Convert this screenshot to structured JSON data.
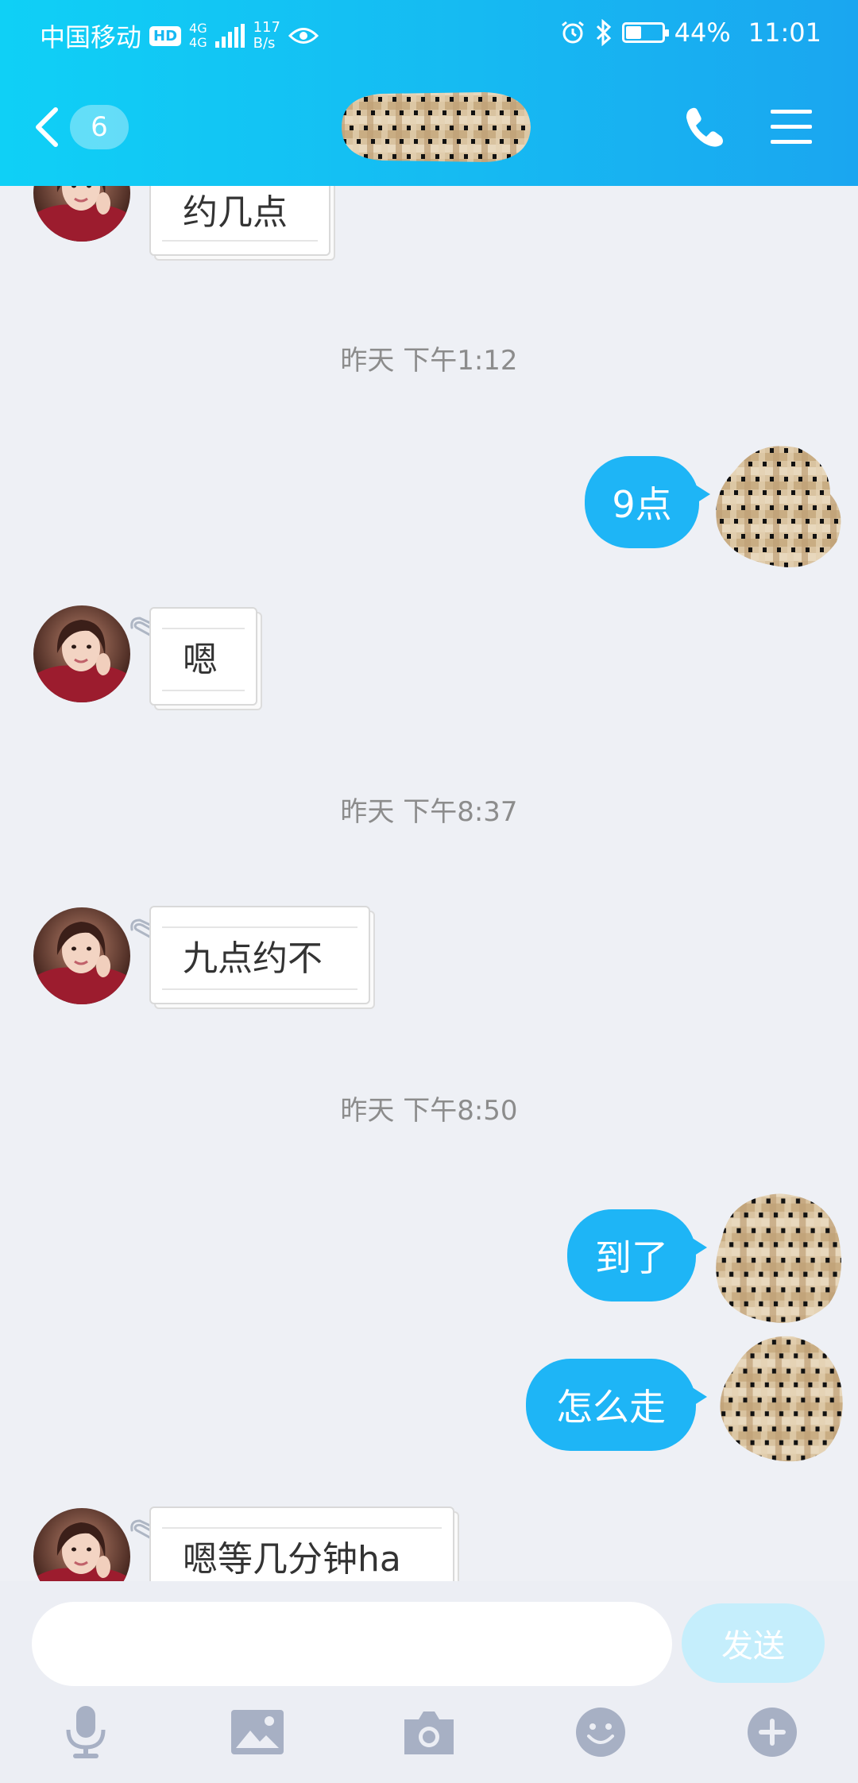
{
  "status_bar": {
    "carrier": "中国移动",
    "hd": "HD",
    "net_top": "4G",
    "net_bottom": "4G",
    "speed_value": "117",
    "speed_unit": "B/s",
    "battery": "44%",
    "battery_level": 0.44,
    "time": "11:01"
  },
  "nav": {
    "back_icon": "chevron-left-icon",
    "unread_count": "6",
    "phone_icon": "phone-icon",
    "menu_icon": "menu-icon"
  },
  "messages": [
    {
      "type": "incoming",
      "text": "约几点"
    },
    {
      "type": "timestamp",
      "text": "昨天 下午1:12"
    },
    {
      "type": "outgoing",
      "text": "9点"
    },
    {
      "type": "incoming",
      "text": "嗯"
    },
    {
      "type": "timestamp",
      "text": "昨天 下午8:37"
    },
    {
      "type": "incoming",
      "text": "九点约不"
    },
    {
      "type": "timestamp",
      "text": "昨天 下午8:50"
    },
    {
      "type": "outgoing",
      "text": "到了"
    },
    {
      "type": "outgoing",
      "text": "怎么走"
    },
    {
      "type": "incoming",
      "text": "嗯等几分钟ha"
    }
  ],
  "input": {
    "placeholder": "",
    "send_label": "发送"
  },
  "toolbar": [
    "microphone-icon",
    "image-icon",
    "camera-icon",
    "emoji-icon",
    "plus-icon"
  ],
  "colors": {
    "header_gradient_start": "#0fd0f6",
    "header_gradient_end": "#1aa6f0",
    "outgoing_bubble": "#1eb5f6",
    "background": "#eef0f5",
    "send_button": "#c5eefc"
  }
}
